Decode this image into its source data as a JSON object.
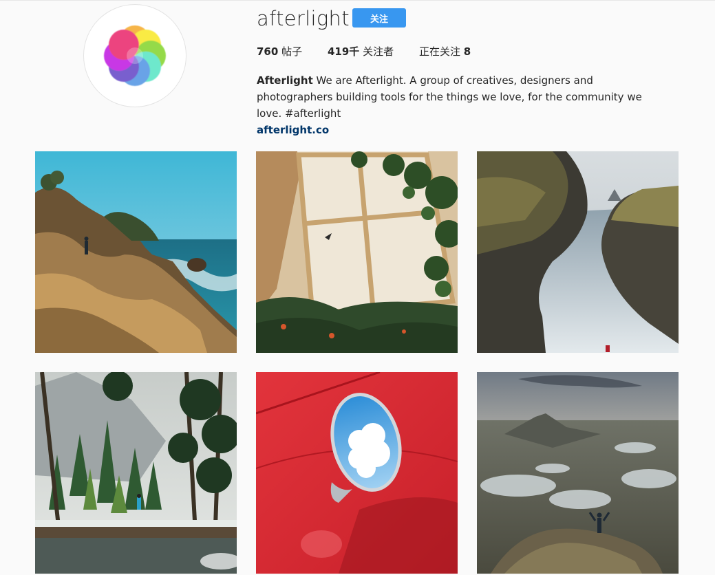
{
  "profile": {
    "username": "afterlight",
    "follow_label": "关注",
    "stats": {
      "posts_count": "760",
      "posts_label": " 帖子",
      "followers_count": "419千",
      "followers_label": " 关注者",
      "following_label": "正在关注 ",
      "following_count": "8"
    },
    "bio": {
      "name": "Afterlight",
      "text": " We are Afterlight. A group of creatives, designers and photographers building tools for the things we love, for the community we love. #afterlight",
      "link": "afterlight.co"
    },
    "avatar_icon": "afterlight-logo-icon"
  },
  "posts": [
    {
      "subject": "coastal cliffs with hiker"
    },
    {
      "subject": "window with plants"
    },
    {
      "subject": "sea cliffs fjord"
    },
    {
      "subject": "forest river with person"
    },
    {
      "subject": "round mirror on red car"
    },
    {
      "subject": "person on mountain top lakes"
    }
  ],
  "colors": {
    "accent": "#3897f0",
    "link": "#003569",
    "text": "#262626",
    "background": "#fafafa"
  }
}
